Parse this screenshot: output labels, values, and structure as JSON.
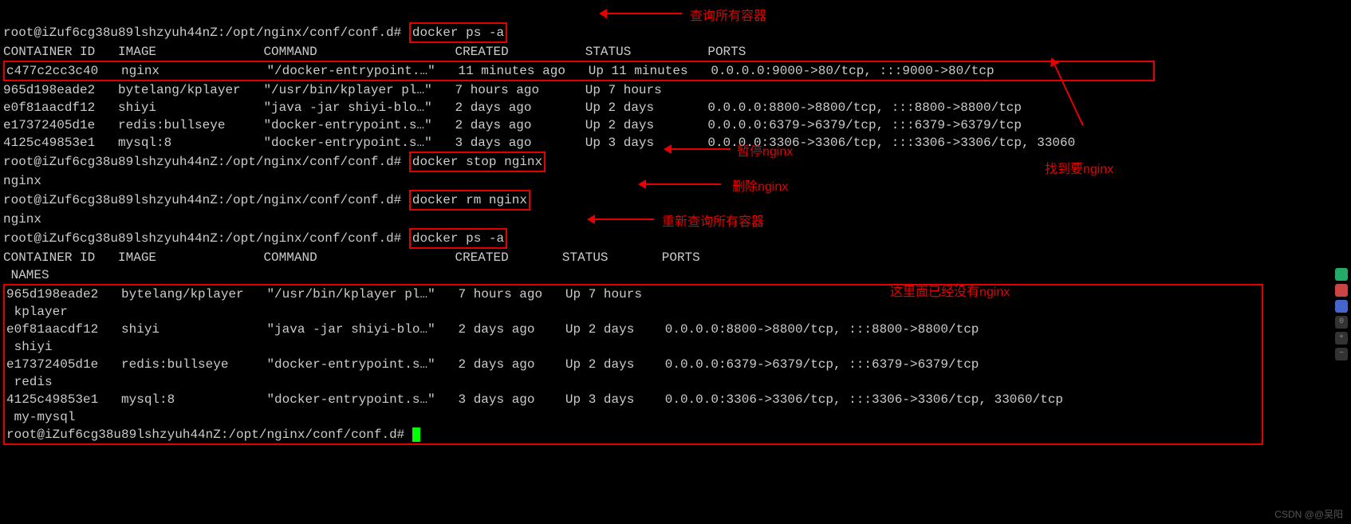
{
  "prompt": "root@iZuf6cg38u89lshzyuh44nZ:/opt/nginx/conf/conf.d#",
  "cmd1": "docker ps -a",
  "header1": "CONTAINER ID   IMAGE              COMMAND                  CREATED          STATUS          PORTS",
  "row_nginx": "c477c2cc3c40   nginx              \"/docker-entrypoint.…\"   11 minutes ago   Up 11 minutes   0.0.0.0:9000->80/tcp, :::9000->80/tcp",
  "row_kp1": "965d198eade2   bytelang/kplayer   \"/usr/bin/kplayer pl…\"   7 hours ago      Up 7 hours",
  "row_shiyi1": "e0f81aacdf12   shiyi              \"java -jar shiyi-blo…\"   2 days ago       Up 2 days       0.0.0.0:8800->8800/tcp, :::8800->8800/tcp",
  "row_redis1": "e17372405d1e   redis:bullseye     \"docker-entrypoint.s…\"   2 days ago       Up 2 days       0.0.0.0:6379->6379/tcp, :::6379->6379/tcp",
  "row_mysql1": "4125c49853e1   mysql:8            \"docker-entrypoint.s…\"   3 days ago       Up 3 days       0.0.0.0:3306->3306/tcp, :::3306->3306/tcp, 33060",
  "cmd2": "docker stop nginx",
  "out2": "nginx",
  "cmd3": "docker rm nginx",
  "out3": "nginx",
  "cmd4": "docker ps -a",
  "header2a": "CONTAINER ID   IMAGE              COMMAND                  CREATED       STATUS       PORTS",
  "header2b": " NAMES",
  "r2_kp": "965d198eade2   bytelang/kplayer   \"/usr/bin/kplayer pl…\"   7 hours ago   Up 7 hours",
  "r2_kp_n": " kplayer",
  "r2_sh": "e0f81aacdf12   shiyi              \"java -jar shiyi-blo…\"   2 days ago    Up 2 days    0.0.0.0:8800->8800/tcp, :::8800->8800/tcp",
  "r2_sh_n": " shiyi",
  "r2_rd": "e17372405d1e   redis:bullseye     \"docker-entrypoint.s…\"   2 days ago    Up 2 days    0.0.0.0:6379->6379/tcp, :::6379->6379/tcp",
  "r2_rd_n": " redis",
  "r2_my": "4125c49853e1   mysql:8            \"docker-entrypoint.s…\"   3 days ago    Up 3 days    0.0.0.0:3306->3306/tcp, :::3306->3306/tcp, 33060/tcp",
  "r2_my_n": " my-mysql",
  "ann1": "查询所有容器",
  "ann2": "找到要nginx",
  "ann3": "暂停nginx",
  "ann4": "删除nginx",
  "ann5": "重新查询所有容器",
  "ann6": "这里面已经没有nginx",
  "watermark": "CSDN @@吴阳"
}
